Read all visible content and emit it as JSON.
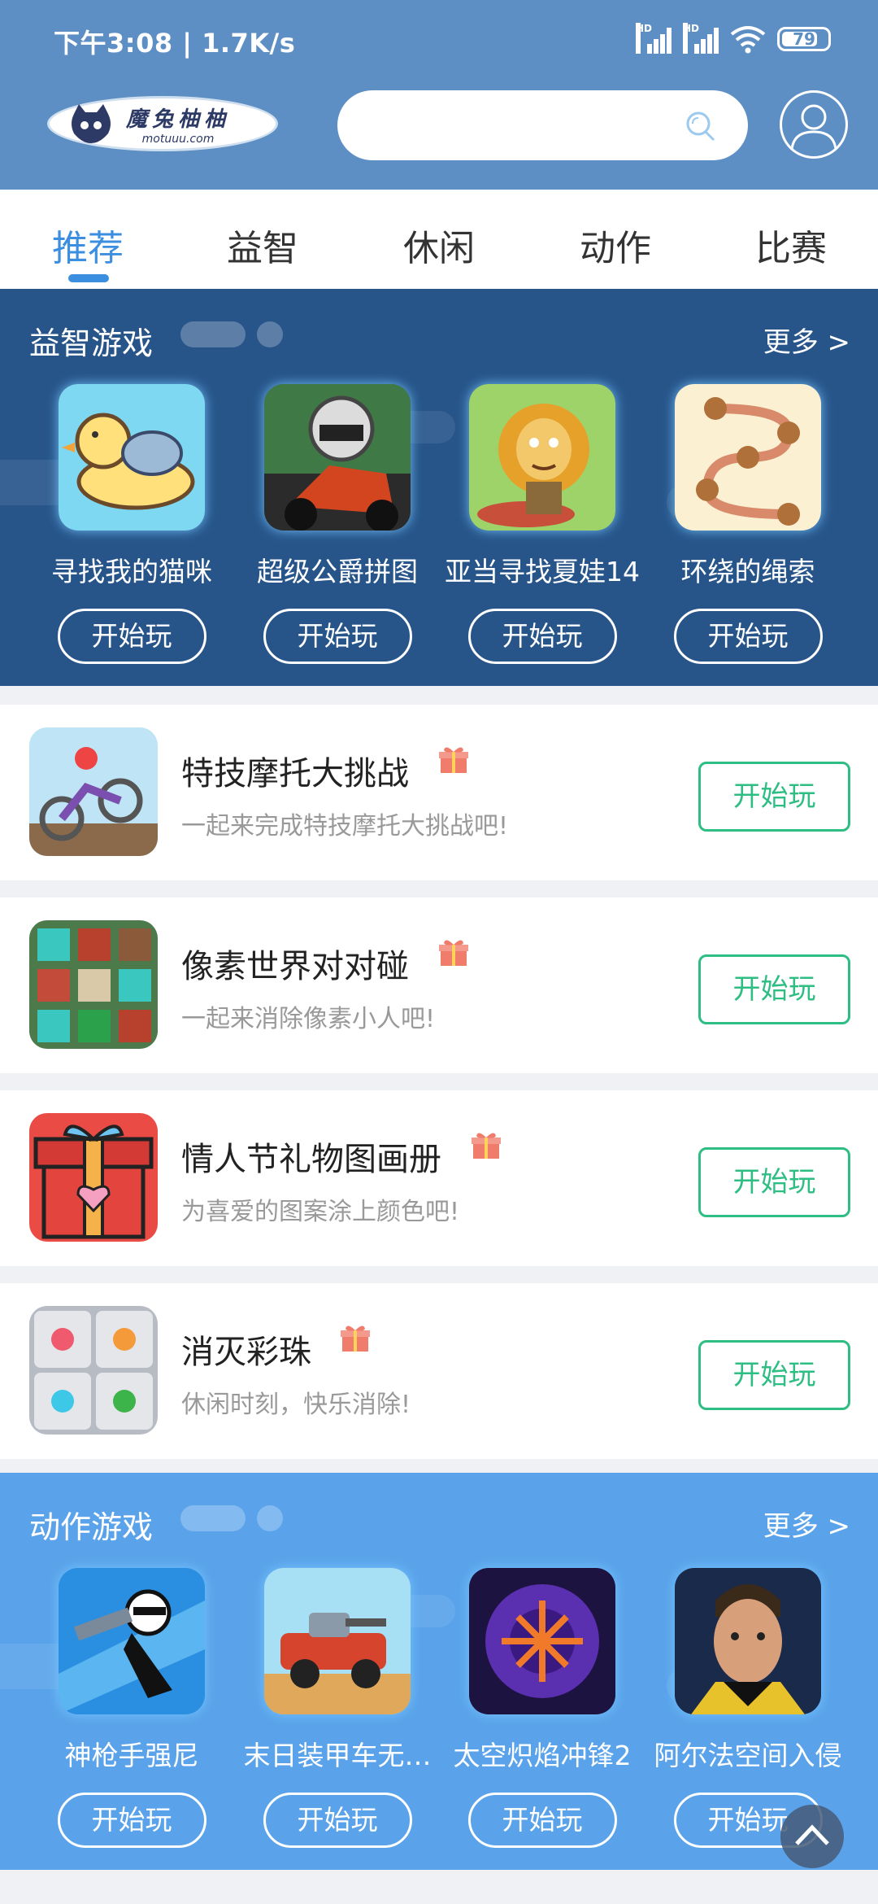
{
  "status": {
    "time": "下午3:08 | 1.7K/s",
    "hd1": "HD",
    "hd2": "HD",
    "battery": "79",
    "battery_level": 0.79
  },
  "colors": {
    "header": "#5d8fc4",
    "accent": "#3c8fe0",
    "green": "#2ebd82",
    "puzzle_bg": "#27558a",
    "action_bg": "#5aa3ea"
  },
  "logo": {
    "title": "魔兔柚柚",
    "domain": "motuuu.com"
  },
  "search": {
    "placeholder": ""
  },
  "tabs": [
    "推荐",
    "益智",
    "休闲",
    "动作",
    "比赛"
  ],
  "puzzle": {
    "title": "益智游戏",
    "more": "更多 >",
    "games": [
      {
        "name": "寻找我的猫咪",
        "button": "开始玩"
      },
      {
        "name": "超级公爵拼图",
        "button": "开始玩"
      },
      {
        "name": "亚当寻找夏娃14",
        "button": "开始玩"
      },
      {
        "name": "环绕的绳索",
        "button": "开始玩"
      }
    ]
  },
  "list": [
    {
      "name": "特技摩托大挑战",
      "desc": "一起来完成特技摩托大挑战吧!",
      "button": "开始玩"
    },
    {
      "name": "像素世界对对碰",
      "desc": "一起来消除像素小人吧!",
      "button": "开始玩"
    },
    {
      "name": "情人节礼物图画册",
      "desc": "为喜爱的图案涂上颜色吧!",
      "button": "开始玩"
    },
    {
      "name": "消灭彩珠",
      "desc": "休闲时刻，快乐消除!",
      "button": "开始玩"
    }
  ],
  "action": {
    "title": "动作游戏",
    "more": "更多 >",
    "games": [
      {
        "name": "神枪手强尼",
        "button": "开始玩"
      },
      {
        "name": "末日装甲车无…",
        "button": "开始玩"
      },
      {
        "name": "太空炽焰冲锋2",
        "button": "开始玩"
      },
      {
        "name": "阿尔法空间入侵",
        "button": "开始玩"
      }
    ]
  }
}
